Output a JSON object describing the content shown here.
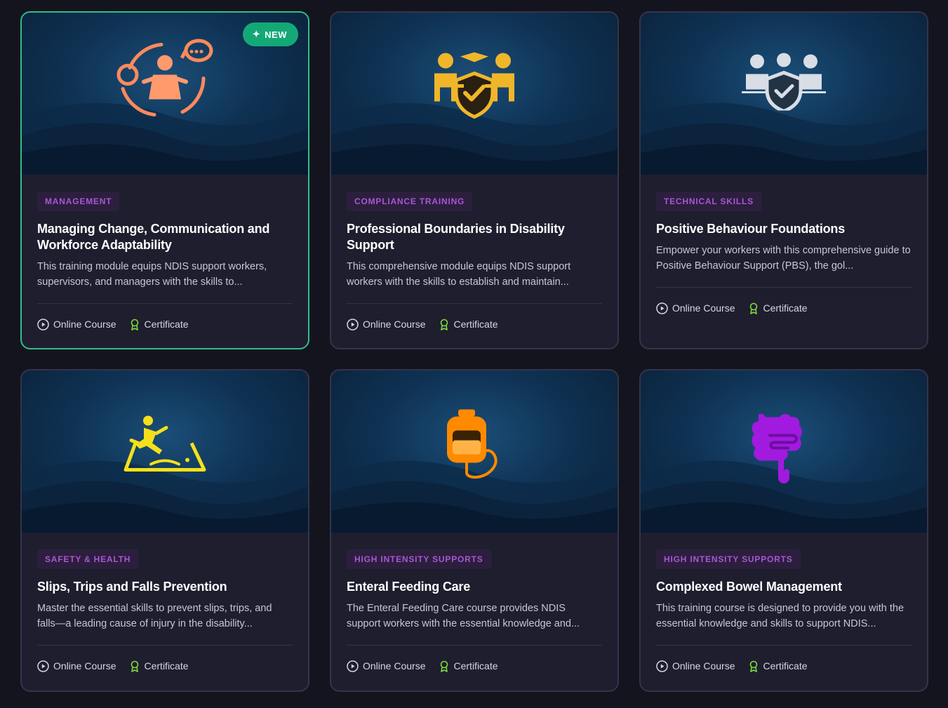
{
  "new_badge": "NEW",
  "meta": {
    "course_type": "Online Course",
    "certificate": "Certificate"
  },
  "colors": {
    "featured_border": "#2fbf86",
    "tag_text": "#a856d6",
    "badge_bg": "#14a876"
  },
  "courses": [
    {
      "tag": "MANAGEMENT",
      "title": "Managing Change, Communication and Workforce Adaptability",
      "description": "This training module equips NDIS support workers, supervisors, and managers with the skills to...",
      "icon": "change-management-icon",
      "icon_color": "#ff8a5c",
      "featured": true
    },
    {
      "tag": "COMPLIANCE TRAINING",
      "title": "Professional Boundaries in Disability Support",
      "description": "This comprehensive module equips NDIS support workers with the skills to establish and maintain...",
      "icon": "handshake-shield-icon",
      "icon_color": "#f0b62a"
    },
    {
      "tag": "TECHNICAL SKILLS",
      "title": "Positive Behaviour Foundations",
      "description": "Empower your workers with this comprehensive guide to Positive Behaviour Support (PBS), the gol...",
      "icon": "group-shield-icon",
      "icon_color": "#d8dde6"
    },
    {
      "tag": "SAFETY & HEALTH",
      "title": "Slips, Trips and Falls Prevention",
      "description": "Master the essential skills to prevent slips, trips, and falls—a leading cause of injury in the disability...",
      "icon": "slip-hazard-icon",
      "icon_color": "#f5e01a"
    },
    {
      "tag": "HIGH INTENSITY SUPPORTS",
      "title": "Enteral Feeding Care",
      "description": "The Enteral Feeding Care course provides NDIS support workers with the essential knowledge and...",
      "icon": "feeding-bag-icon",
      "icon_color": "#ff8a00"
    },
    {
      "tag": "HIGH INTENSITY SUPPORTS",
      "title": "Complexed Bowel Management",
      "description": "This training course is designed to provide you with the essential knowledge and skills to support NDIS...",
      "icon": "intestine-icon",
      "icon_color": "#a21ae0"
    }
  ]
}
